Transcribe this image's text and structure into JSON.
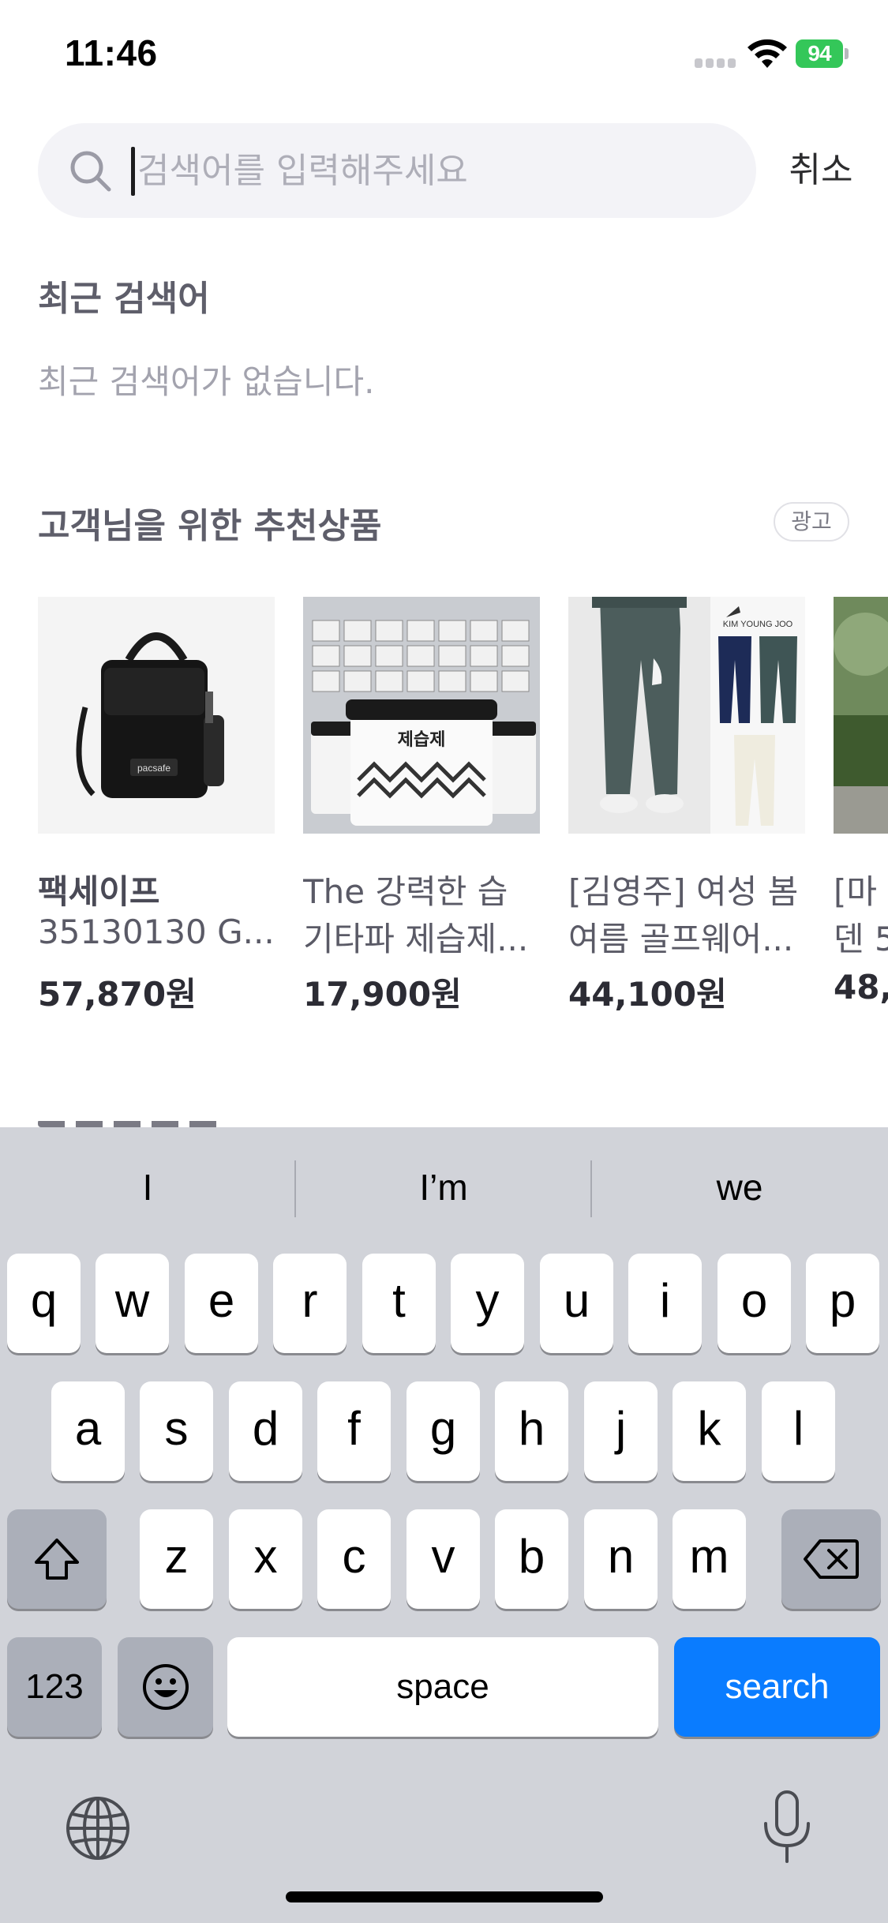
{
  "status_bar": {
    "time": "11:46",
    "battery": "94"
  },
  "search": {
    "placeholder": "검색어를 입력해주세요",
    "value": "",
    "cancel_label": "취소"
  },
  "recent": {
    "title": "최근 검색어",
    "empty_message": "최근 검색어가 없습니다."
  },
  "recommendations": {
    "title": "고객님을 위한 추천상품",
    "ad_label": "광고",
    "products": [
      {
        "brand": "팩세이프",
        "name": "35130130 G...",
        "price": "57,870원",
        "image_label": "pacsafe"
      },
      {
        "brand": "",
        "name_line1": "The 강력한 습",
        "name_line2": "기타파 제습제...",
        "price": "17,900원",
        "image_label": "제습제"
      },
      {
        "brand": "",
        "name_line1": "[김영주] 여성 봄",
        "name_line2": "여름 골프웨어...",
        "price": "44,100원",
        "image_label": "KIM YOUNG JOO"
      },
      {
        "brand": "",
        "name_line1": "[마",
        "name_line2": "덴 5",
        "price": "48,",
        "image_label": ""
      }
    ]
  },
  "keyboard": {
    "suggestions": [
      "I",
      "I’m",
      "we"
    ],
    "row1": [
      "q",
      "w",
      "e",
      "r",
      "t",
      "y",
      "u",
      "i",
      "o",
      "p"
    ],
    "row2": [
      "a",
      "s",
      "d",
      "f",
      "g",
      "h",
      "j",
      "k",
      "l"
    ],
    "row3": [
      "z",
      "x",
      "c",
      "v",
      "b",
      "n",
      "m"
    ],
    "numbers_label": "123",
    "space_label": "space",
    "action_label": "search",
    "accent_color": "#0a7cff"
  }
}
